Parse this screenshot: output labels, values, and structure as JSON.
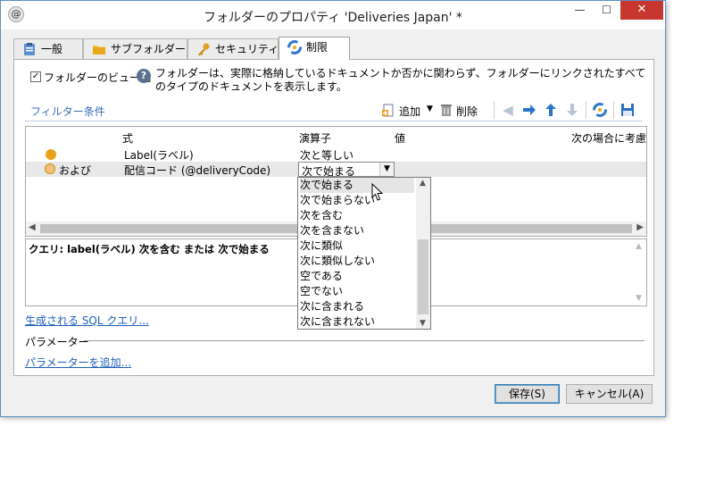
{
  "window": {
    "title": "フォルダーのプロパティ 'Deliveries Japan' *",
    "minimize_glyph": "—",
    "maximize_glyph": "☐",
    "close_glyph": "✕",
    "app_icon_glyph": "@"
  },
  "tabs": [
    {
      "label": "一般",
      "icon": "clipboard-icon"
    },
    {
      "label": "サブフォルダー",
      "icon": "folder-icon"
    },
    {
      "label": "セキュリティ",
      "icon": "key-icon"
    },
    {
      "label": "制限",
      "icon": "restriction-icon",
      "active": true
    }
  ],
  "folder_view": {
    "checkbox_label": "フォルダーのビュー化",
    "checked": true,
    "check_glyph": "✓",
    "help_glyph": "?",
    "info_text": "フォルダーは、実際に格納しているドキュメントか否かに関わらず、フォルダーにリンクされたすべてのタイプのドキュメントを表示します。"
  },
  "filter": {
    "title": "フィルター条件",
    "toolbar": {
      "add_label": "追加",
      "delete_label": "削除"
    },
    "columns": {
      "expression": "式",
      "operator": "演算子",
      "value": "値",
      "condition": "次の場合に考慮"
    },
    "rows": [
      {
        "prefix": "",
        "expression": "Label(ラベル)",
        "operator": "次と等しい"
      },
      {
        "prefix": "および",
        "expression": "配信コード (@deliveryCode)",
        "operator": "次で始まる"
      }
    ]
  },
  "dropdown": {
    "options": [
      "次で始まる",
      "次で始まらない",
      "次を含む",
      "次を含まない",
      "次に類似",
      "次に類似しない",
      "空である",
      "空でない",
      "次に含まれる",
      "次に含まれない"
    ],
    "selected_index": 0
  },
  "query": {
    "text": "クエリ: label(ラベル) 次を含む または 次で始まる"
  },
  "sql_link": "生成される SQL クエリ...",
  "parameters": {
    "label": "パラメーター",
    "add_link": "パラメーターを追加..."
  },
  "buttons": {
    "save": "保存(S)",
    "cancel": "キャンセル(A)"
  },
  "colors": {
    "accent": "#3a6fb5",
    "link": "#1d5fb9",
    "close_button": "#c7372f",
    "row_dot": "#e9a31a"
  }
}
